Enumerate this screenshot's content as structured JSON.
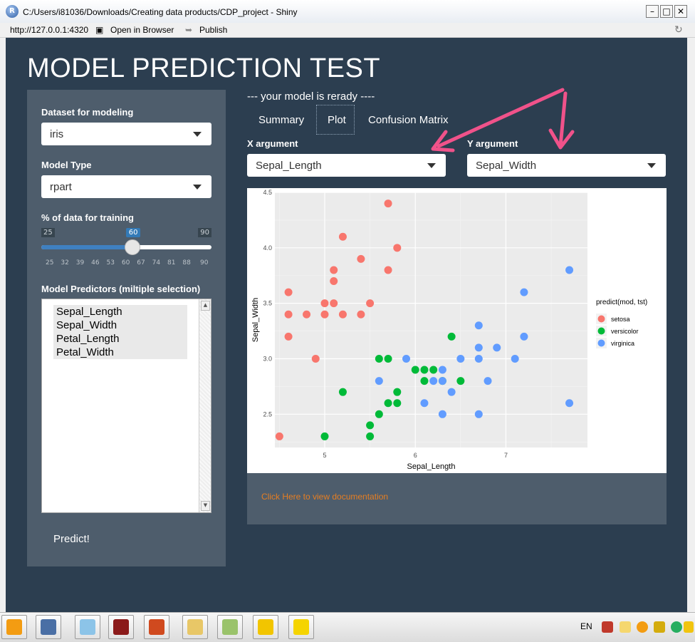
{
  "window": {
    "title": "C:/Users/i81036/Downloads/Creating data products/CDP_project - Shiny",
    "icon_letter": "R",
    "address": "http://127.0.0.1:4320",
    "open_browser": "Open in Browser",
    "publish": "Publish"
  },
  "app": {
    "title": "MODEL PREDICTION TEST",
    "status": "--- your model is rerady ----"
  },
  "sidebar": {
    "dataset_label": "Dataset for modeling",
    "dataset_value": "iris",
    "model_label": "Model Type",
    "model_value": "rpart",
    "pct_label": "% of data for training",
    "slider": {
      "min": "25",
      "max": "90",
      "value": "60",
      "fraction": 0.538,
      "ticks": [
        "25",
        "32",
        "39",
        "46",
        "53",
        "60",
        "67",
        "74",
        "81",
        "88",
        "90"
      ]
    },
    "predictors_label": "Model Predictors (miltiple selection)",
    "predictors": [
      "Sepal_Length",
      "Sepal_Width",
      "Petal_Length",
      "Petal_Width"
    ],
    "predict_button": "Predict!"
  },
  "tabs": [
    {
      "label": "Summary",
      "active": false
    },
    {
      "label": "Plot",
      "active": true
    },
    {
      "label": "Confusion Matrix",
      "active": false
    }
  ],
  "x_arg": {
    "label": "X argument",
    "value": "Sepal_Length"
  },
  "y_arg": {
    "label": "Y argument",
    "value": "Sepal_Width"
  },
  "doc_link": "Click Here to view documentation",
  "colors": {
    "setosa": "#f8766d",
    "versicolor": "#00ba38",
    "virginica": "#619cff",
    "bg": "#2c3e50",
    "panel": "#4e5d6c",
    "arrow": "#f0528a"
  },
  "taskbar": {
    "lang": "EN"
  },
  "chart_data": {
    "type": "scatter",
    "xlabel": "Sepal_Length",
    "ylabel": "Sepal_Width",
    "xlim": [
      4.45,
      7.9
    ],
    "ylim": [
      2.2,
      4.5
    ],
    "xticks": [
      5,
      6,
      7
    ],
    "yticks": [
      2.5,
      3.0,
      3.5,
      4.0,
      4.5
    ],
    "legend_title": "predict(mod, tst)",
    "legend_position": "right",
    "grid": true,
    "series": [
      {
        "name": "setosa",
        "color": "#f8766d",
        "points": [
          [
            4.5,
            2.3
          ],
          [
            4.6,
            3.2
          ],
          [
            4.6,
            3.4
          ],
          [
            4.6,
            3.6
          ],
          [
            4.8,
            3.4
          ],
          [
            4.9,
            3.0
          ],
          [
            5.0,
            3.4
          ],
          [
            5.0,
            3.5
          ],
          [
            5.1,
            3.5
          ],
          [
            5.1,
            3.7
          ],
          [
            5.1,
            3.8
          ],
          [
            5.2,
            3.4
          ],
          [
            5.2,
            4.1
          ],
          [
            5.4,
            3.4
          ],
          [
            5.4,
            3.9
          ],
          [
            5.5,
            3.5
          ],
          [
            5.7,
            3.8
          ],
          [
            5.7,
            4.4
          ],
          [
            5.8,
            4.0
          ]
        ]
      },
      {
        "name": "versicolor",
        "color": "#00ba38",
        "points": [
          [
            5.0,
            2.3
          ],
          [
            5.2,
            2.7
          ],
          [
            5.5,
            2.3
          ],
          [
            5.5,
            2.4
          ],
          [
            5.6,
            2.5
          ],
          [
            5.6,
            3.0
          ],
          [
            5.7,
            2.6
          ],
          [
            5.7,
            3.0
          ],
          [
            5.8,
            2.6
          ],
          [
            5.8,
            2.7
          ],
          [
            6.0,
            2.9
          ],
          [
            6.1,
            2.8
          ],
          [
            6.1,
            2.9
          ],
          [
            6.2,
            2.9
          ],
          [
            6.3,
            2.8
          ],
          [
            6.4,
            3.2
          ],
          [
            6.5,
            2.8
          ]
        ]
      },
      {
        "name": "virginica",
        "color": "#619cff",
        "points": [
          [
            5.6,
            2.8
          ],
          [
            5.9,
            3.0
          ],
          [
            6.1,
            2.6
          ],
          [
            6.2,
            2.8
          ],
          [
            6.3,
            2.5
          ],
          [
            6.3,
            2.8
          ],
          [
            6.3,
            2.9
          ],
          [
            6.4,
            2.7
          ],
          [
            6.5,
            3.0
          ],
          [
            6.7,
            2.5
          ],
          [
            6.7,
            3.0
          ],
          [
            6.7,
            3.1
          ],
          [
            6.7,
            3.3
          ],
          [
            6.8,
            2.8
          ],
          [
            6.9,
            3.1
          ],
          [
            7.1,
            3.0
          ],
          [
            7.2,
            3.2
          ],
          [
            7.2,
            3.6
          ],
          [
            7.7,
            2.6
          ],
          [
            7.7,
            3.8
          ]
        ]
      }
    ]
  }
}
